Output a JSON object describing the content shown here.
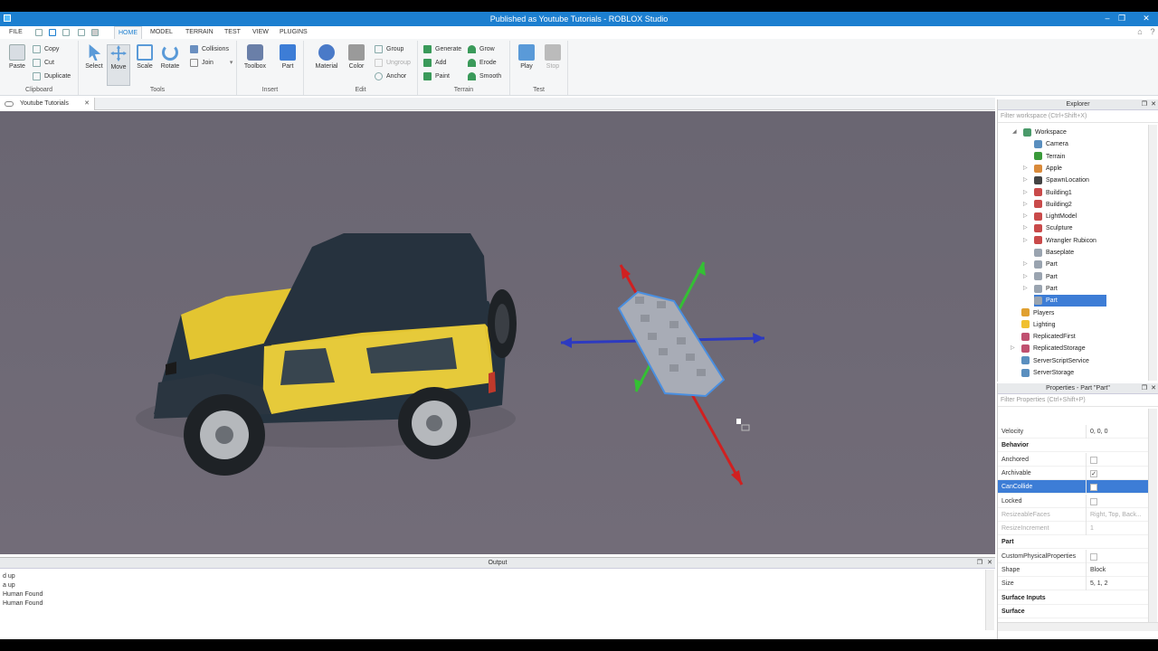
{
  "window": {
    "title": "Published as Youtube Tutorials - ROBLOX Studio"
  },
  "menu": {
    "file": "FILE",
    "tabs": [
      "HOME",
      "MODEL",
      "TERRAIN",
      "TEST",
      "VIEW",
      "PLUGINS"
    ]
  },
  "ribbon": {
    "clipboard": {
      "label": "Clipboard",
      "paste": "Paste",
      "copy": "Copy",
      "cut": "Cut",
      "duplicate": "Duplicate"
    },
    "tools": {
      "label": "Tools",
      "select": "Select",
      "move": "Move",
      "scale": "Scale",
      "rotate": "Rotate",
      "collisions": "Collisions",
      "join": "Join"
    },
    "insert": {
      "label": "Insert",
      "toolbox": "Toolbox",
      "part": "Part"
    },
    "edit": {
      "label": "Edit",
      "material": "Material",
      "color": "Color",
      "group": "Group",
      "ungroup": "Ungroup",
      "anchor": "Anchor"
    },
    "terrain": {
      "label": "Terrain",
      "generate": "Generate",
      "add": "Add",
      "paint": "Paint",
      "grow": "Grow",
      "erode": "Erode",
      "smooth": "Smooth"
    },
    "test": {
      "label": "Test",
      "play": "Play",
      "stop": "Stop"
    }
  },
  "document_tab": {
    "label": "Youtube Tutorials"
  },
  "output": {
    "title": "Output",
    "lines": [
      "d up",
      "a up",
      "Human Found",
      "Human Found"
    ]
  },
  "explorer": {
    "title": "Explorer",
    "filter_placeholder": "Filter workspace (Ctrl+Shift+X)",
    "items": [
      {
        "label": "Workspace",
        "icon": "globe-icon",
        "color": "#4a9a6a"
      },
      {
        "label": "Camera",
        "icon": "camera-icon",
        "color": "#5a8fbf"
      },
      {
        "label": "Terrain",
        "icon": "terrain-icon",
        "color": "#3a9a3a"
      },
      {
        "label": "Apple",
        "icon": "tool-icon",
        "color": "#d98a3a"
      },
      {
        "label": "SpawnLocation",
        "icon": "spawn-icon",
        "color": "#444444"
      },
      {
        "label": "Building1",
        "icon": "model-icon",
        "color": "#c94a4a"
      },
      {
        "label": "Building2",
        "icon": "model-icon",
        "color": "#c94a4a"
      },
      {
        "label": "LightModel",
        "icon": "model-icon",
        "color": "#c94a4a"
      },
      {
        "label": "Sculpture",
        "icon": "model-icon",
        "color": "#c94a4a"
      },
      {
        "label": "Wrangler Rubicon",
        "icon": "model-icon",
        "color": "#c94a4a"
      },
      {
        "label": "Baseplate",
        "icon": "part-icon",
        "color": "#9aa4b0"
      },
      {
        "label": "Part",
        "icon": "part-icon",
        "color": "#9aa4b0"
      },
      {
        "label": "Part",
        "icon": "part-icon",
        "color": "#9aa4b0"
      },
      {
        "label": "Part",
        "icon": "part-icon",
        "color": "#9aa4b0"
      },
      {
        "label": "Part",
        "icon": "part-icon",
        "color": "#9aa4b0"
      },
      {
        "label": "Players",
        "icon": "players-icon",
        "color": "#e0a030"
      },
      {
        "label": "Lighting",
        "icon": "lighting-icon",
        "color": "#f0c030"
      },
      {
        "label": "ReplicatedFirst",
        "icon": "replicated-icon",
        "color": "#c05070"
      },
      {
        "label": "ReplicatedStorage",
        "icon": "replicated-icon",
        "color": "#c05070"
      },
      {
        "label": "ServerScriptService",
        "icon": "script-service-icon",
        "color": "#5a8fbf"
      },
      {
        "label": "ServerStorage",
        "icon": "storage-icon",
        "color": "#5a8fbf"
      }
    ]
  },
  "properties": {
    "title": "Properties - Part \"Part\"",
    "filter_placeholder": "Filter Properties (Ctrl+Shift+P)",
    "rows": [
      {
        "name": "Velocity",
        "value": "0, 0, 0"
      },
      {
        "name": "Behavior",
        "header": true
      },
      {
        "name": "Anchored",
        "checkbox": false
      },
      {
        "name": "Archivable",
        "checkbox": true
      },
      {
        "name": "CanCollide",
        "checkbox": false,
        "selected": true
      },
      {
        "name": "Locked",
        "checkbox": false
      },
      {
        "name": "ResizeableFaces",
        "value": "Right, Top, Back...",
        "dim": true
      },
      {
        "name": "ResizeIncrement",
        "value": "1",
        "dim": true
      },
      {
        "name": "Part",
        "header": true
      },
      {
        "name": "CustomPhysicalProperties",
        "checkbox": false
      },
      {
        "name": "Shape",
        "value": "Block"
      },
      {
        "name": "Size",
        "value": "5, 1, 2"
      },
      {
        "name": "Surface Inputs",
        "header": true
      },
      {
        "name": "Surface",
        "header": true
      }
    ]
  },
  "colors": {
    "accent": "#1c7fd0",
    "selection": "#3d7dd6",
    "viewport": "#6e6975"
  }
}
